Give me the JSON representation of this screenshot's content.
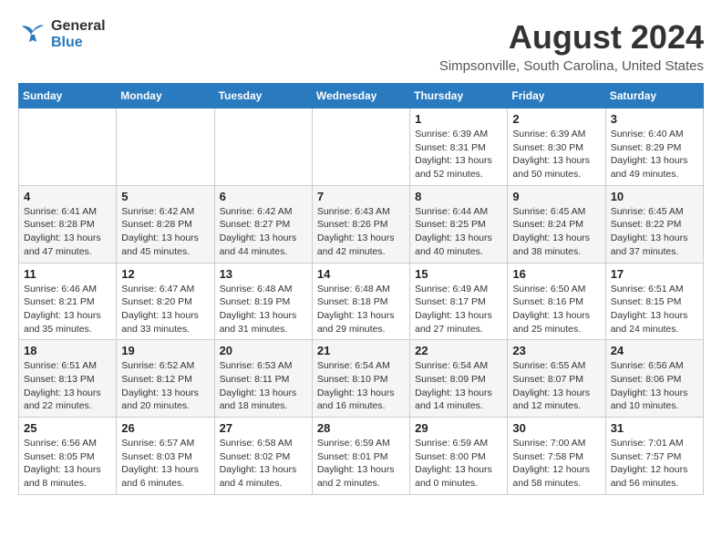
{
  "header": {
    "logo_line1": "General",
    "logo_line2": "Blue",
    "month": "August 2024",
    "location": "Simpsonville, South Carolina, United States"
  },
  "days_of_week": [
    "Sunday",
    "Monday",
    "Tuesday",
    "Wednesday",
    "Thursday",
    "Friday",
    "Saturday"
  ],
  "weeks": [
    [
      {
        "day": "",
        "info": ""
      },
      {
        "day": "",
        "info": ""
      },
      {
        "day": "",
        "info": ""
      },
      {
        "day": "",
        "info": ""
      },
      {
        "day": "1",
        "info": "Sunrise: 6:39 AM\nSunset: 8:31 PM\nDaylight: 13 hours\nand 52 minutes."
      },
      {
        "day": "2",
        "info": "Sunrise: 6:39 AM\nSunset: 8:30 PM\nDaylight: 13 hours\nand 50 minutes."
      },
      {
        "day": "3",
        "info": "Sunrise: 6:40 AM\nSunset: 8:29 PM\nDaylight: 13 hours\nand 49 minutes."
      }
    ],
    [
      {
        "day": "4",
        "info": "Sunrise: 6:41 AM\nSunset: 8:28 PM\nDaylight: 13 hours\nand 47 minutes."
      },
      {
        "day": "5",
        "info": "Sunrise: 6:42 AM\nSunset: 8:28 PM\nDaylight: 13 hours\nand 45 minutes."
      },
      {
        "day": "6",
        "info": "Sunrise: 6:42 AM\nSunset: 8:27 PM\nDaylight: 13 hours\nand 44 minutes."
      },
      {
        "day": "7",
        "info": "Sunrise: 6:43 AM\nSunset: 8:26 PM\nDaylight: 13 hours\nand 42 minutes."
      },
      {
        "day": "8",
        "info": "Sunrise: 6:44 AM\nSunset: 8:25 PM\nDaylight: 13 hours\nand 40 minutes."
      },
      {
        "day": "9",
        "info": "Sunrise: 6:45 AM\nSunset: 8:24 PM\nDaylight: 13 hours\nand 38 minutes."
      },
      {
        "day": "10",
        "info": "Sunrise: 6:45 AM\nSunset: 8:22 PM\nDaylight: 13 hours\nand 37 minutes."
      }
    ],
    [
      {
        "day": "11",
        "info": "Sunrise: 6:46 AM\nSunset: 8:21 PM\nDaylight: 13 hours\nand 35 minutes."
      },
      {
        "day": "12",
        "info": "Sunrise: 6:47 AM\nSunset: 8:20 PM\nDaylight: 13 hours\nand 33 minutes."
      },
      {
        "day": "13",
        "info": "Sunrise: 6:48 AM\nSunset: 8:19 PM\nDaylight: 13 hours\nand 31 minutes."
      },
      {
        "day": "14",
        "info": "Sunrise: 6:48 AM\nSunset: 8:18 PM\nDaylight: 13 hours\nand 29 minutes."
      },
      {
        "day": "15",
        "info": "Sunrise: 6:49 AM\nSunset: 8:17 PM\nDaylight: 13 hours\nand 27 minutes."
      },
      {
        "day": "16",
        "info": "Sunrise: 6:50 AM\nSunset: 8:16 PM\nDaylight: 13 hours\nand 25 minutes."
      },
      {
        "day": "17",
        "info": "Sunrise: 6:51 AM\nSunset: 8:15 PM\nDaylight: 13 hours\nand 24 minutes."
      }
    ],
    [
      {
        "day": "18",
        "info": "Sunrise: 6:51 AM\nSunset: 8:13 PM\nDaylight: 13 hours\nand 22 minutes."
      },
      {
        "day": "19",
        "info": "Sunrise: 6:52 AM\nSunset: 8:12 PM\nDaylight: 13 hours\nand 20 minutes."
      },
      {
        "day": "20",
        "info": "Sunrise: 6:53 AM\nSunset: 8:11 PM\nDaylight: 13 hours\nand 18 minutes."
      },
      {
        "day": "21",
        "info": "Sunrise: 6:54 AM\nSunset: 8:10 PM\nDaylight: 13 hours\nand 16 minutes."
      },
      {
        "day": "22",
        "info": "Sunrise: 6:54 AM\nSunset: 8:09 PM\nDaylight: 13 hours\nand 14 minutes."
      },
      {
        "day": "23",
        "info": "Sunrise: 6:55 AM\nSunset: 8:07 PM\nDaylight: 13 hours\nand 12 minutes."
      },
      {
        "day": "24",
        "info": "Sunrise: 6:56 AM\nSunset: 8:06 PM\nDaylight: 13 hours\nand 10 minutes."
      }
    ],
    [
      {
        "day": "25",
        "info": "Sunrise: 6:56 AM\nSunset: 8:05 PM\nDaylight: 13 hours\nand 8 minutes."
      },
      {
        "day": "26",
        "info": "Sunrise: 6:57 AM\nSunset: 8:03 PM\nDaylight: 13 hours\nand 6 minutes."
      },
      {
        "day": "27",
        "info": "Sunrise: 6:58 AM\nSunset: 8:02 PM\nDaylight: 13 hours\nand 4 minutes."
      },
      {
        "day": "28",
        "info": "Sunrise: 6:59 AM\nSunset: 8:01 PM\nDaylight: 13 hours\nand 2 minutes."
      },
      {
        "day": "29",
        "info": "Sunrise: 6:59 AM\nSunset: 8:00 PM\nDaylight: 13 hours\nand 0 minutes."
      },
      {
        "day": "30",
        "info": "Sunrise: 7:00 AM\nSunset: 7:58 PM\nDaylight: 12 hours\nand 58 minutes."
      },
      {
        "day": "31",
        "info": "Sunrise: 7:01 AM\nSunset: 7:57 PM\nDaylight: 12 hours\nand 56 minutes."
      }
    ]
  ]
}
